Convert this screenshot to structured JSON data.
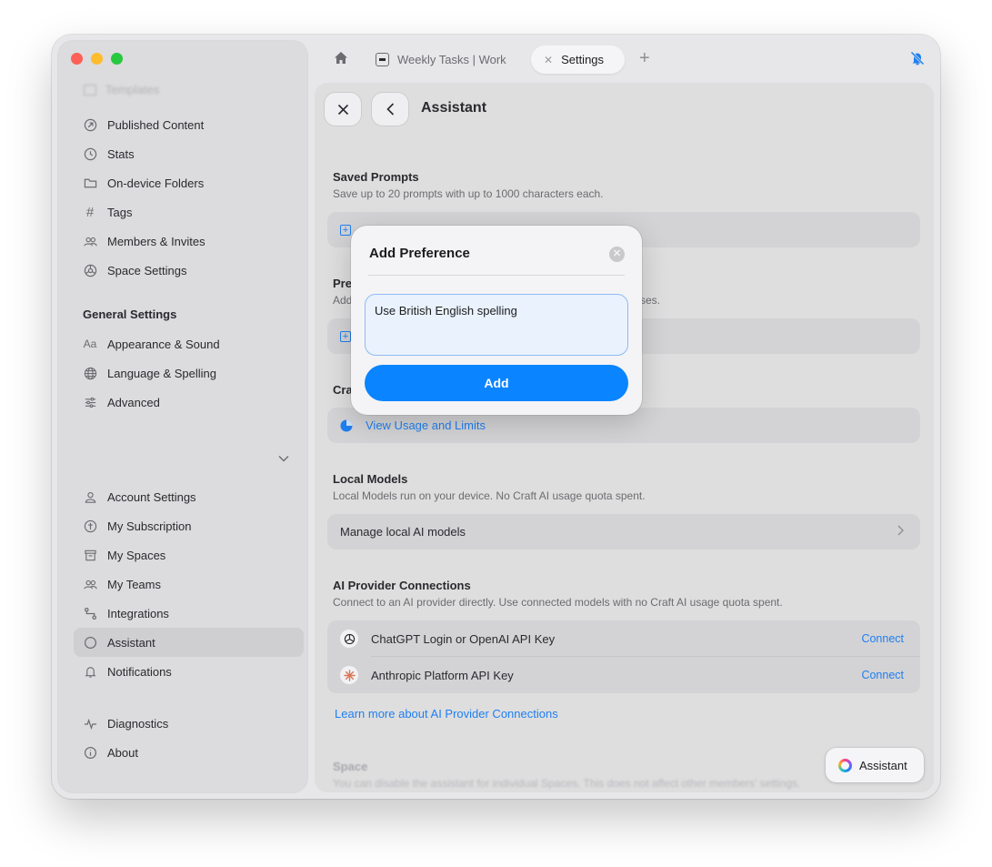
{
  "sidebar": {
    "faded_item": "Templates",
    "items_top": [
      {
        "label": "Published Content",
        "icon": "publish-icon"
      },
      {
        "label": "Stats",
        "icon": "clock-icon"
      },
      {
        "label": "On-device Folders",
        "icon": "folder-icon"
      },
      {
        "label": "Tags",
        "icon": "hash-icon"
      },
      {
        "label": "Members & Invites",
        "icon": "people-icon"
      },
      {
        "label": "Space Settings",
        "icon": "gear-icon"
      }
    ],
    "general_heading": "General Settings",
    "items_general": [
      {
        "label": "Appearance & Sound",
        "icon": "text-aa-icon"
      },
      {
        "label": "Language & Spelling",
        "icon": "globe-icon"
      },
      {
        "label": "Advanced",
        "icon": "sliders-icon"
      }
    ],
    "items_account": [
      {
        "label": "Account Settings",
        "icon": "person-icon"
      },
      {
        "label": "My Subscription",
        "icon": "subscription-icon"
      },
      {
        "label": "My Spaces",
        "icon": "archive-icon"
      },
      {
        "label": "My Teams",
        "icon": "people-icon"
      },
      {
        "label": "Integrations",
        "icon": "integrations-icon"
      },
      {
        "label": "Assistant",
        "icon": "circle-icon",
        "active": true
      },
      {
        "label": "Notifications",
        "icon": "bell-icon"
      }
    ],
    "items_bottom": [
      {
        "label": "Diagnostics",
        "icon": "pulse-icon"
      },
      {
        "label": "About",
        "icon": "info-icon"
      }
    ]
  },
  "tabs": {
    "doc_tab": "Weekly Tasks | Work",
    "settings_tab": "Settings"
  },
  "page": {
    "title": "Assistant",
    "saved_prompts": {
      "title": "Saved Prompts",
      "subtitle": "Save up to 20 prompts with up to 1000 characters each."
    },
    "preferences": {
      "title_visible": "Pre",
      "subtitle_start": "Add",
      "subtitle_end": "ses."
    },
    "craft_section": {
      "title_visible": "Cra",
      "usage_link": "View Usage and Limits"
    },
    "local_models": {
      "title": "Local Models",
      "subtitle": "Local Models run on your device. No Craft AI usage quota spent.",
      "manage": "Manage local AI models"
    },
    "providers": {
      "title": "AI Provider Connections",
      "subtitle": "Connect to an AI provider directly. Use connected models with no Craft AI usage quota spent.",
      "items": [
        {
          "name": "ChatGPT Login or OpenAI API Key",
          "action": "Connect"
        },
        {
          "name": "Anthropic Platform API Key",
          "action": "Connect"
        }
      ],
      "learn_more": "Learn more about AI Provider Connections"
    },
    "space": {
      "title": "Space",
      "subtitle": "You can disable the assistant for individual Spaces. This does not affect other members' settings."
    },
    "assistant_button": "Assistant"
  },
  "modal": {
    "title": "Add Preference",
    "input_value": "Use British English spelling",
    "add_button": "Add"
  },
  "colors": {
    "accent": "#0a84ff",
    "link": "#1f7ff1",
    "traffic_red": "#fe5f57",
    "traffic_yellow": "#febc2e",
    "traffic_green": "#28c840"
  }
}
